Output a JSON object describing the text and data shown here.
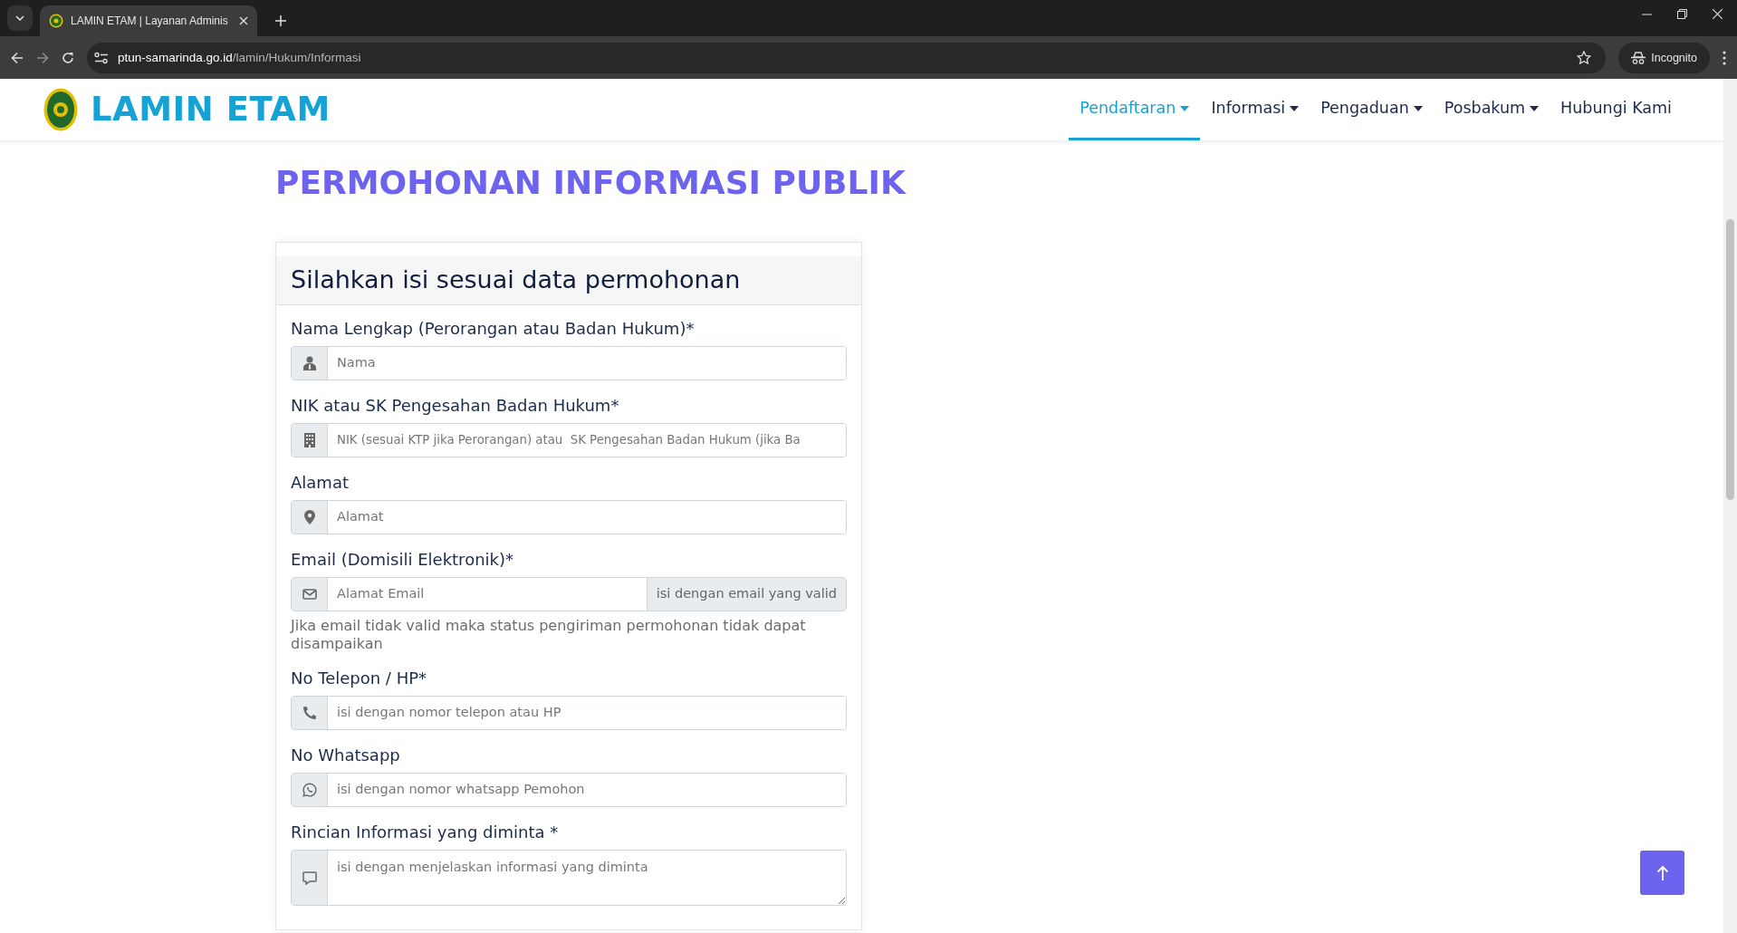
{
  "browser": {
    "tab_title": "LAMIN ETAM | Layanan Adminis",
    "url_host": "ptun-samarinda.go.id",
    "url_path": "/lamin/Hukum/Informasi",
    "incognito_label": "Incognito"
  },
  "site": {
    "brand": "LAMIN ETAM",
    "nav": [
      {
        "label": "Pendaftaran",
        "dropdown": true,
        "selected": true
      },
      {
        "label": "Informasi",
        "dropdown": true,
        "selected": false
      },
      {
        "label": "Pengaduan",
        "dropdown": true,
        "selected": false
      },
      {
        "label": "Posbakum",
        "dropdown": true,
        "selected": false
      },
      {
        "label": "Hubungi Kami",
        "dropdown": false,
        "selected": false
      }
    ]
  },
  "page_title": "PERMOHONAN INFORMASI PUBLIK",
  "form": {
    "heading": "Silahkan isi sesuai data permohonan",
    "fields": [
      {
        "kind": "input",
        "label": "Nama Lengkap (Perorangan atau Badan Hukum)*",
        "placeholder": "Nama"
      },
      {
        "kind": "input",
        "label": "NIK atau SK Pengesahan Badan Hukum*",
        "placeholder": "NIK (sesuai KTP jika Perorangan) atau  SK Pengesahan Badan Hukum (jika Ba"
      },
      {
        "kind": "input",
        "label": "Alamat",
        "placeholder": "Alamat"
      },
      {
        "kind": "input_addon",
        "label": "Email (Domisili Elektronik)*",
        "placeholder": "Alamat Email",
        "addon": "isi dengan email yang valid",
        "help": "Jika email tidak valid maka status pengiriman permohonan tidak dapat disampaikan"
      },
      {
        "kind": "input",
        "label": "No Telepon / HP*",
        "placeholder": "isi dengan nomor telepon atau HP"
      },
      {
        "kind": "input",
        "label": "No Whatsapp",
        "placeholder": "isi dengan nomor whatsapp Pemohon"
      },
      {
        "kind": "textarea",
        "label": "Rincian Informasi yang diminta *",
        "placeholder": "isi dengan menjelaskan informasi yang diminta"
      }
    ]
  }
}
